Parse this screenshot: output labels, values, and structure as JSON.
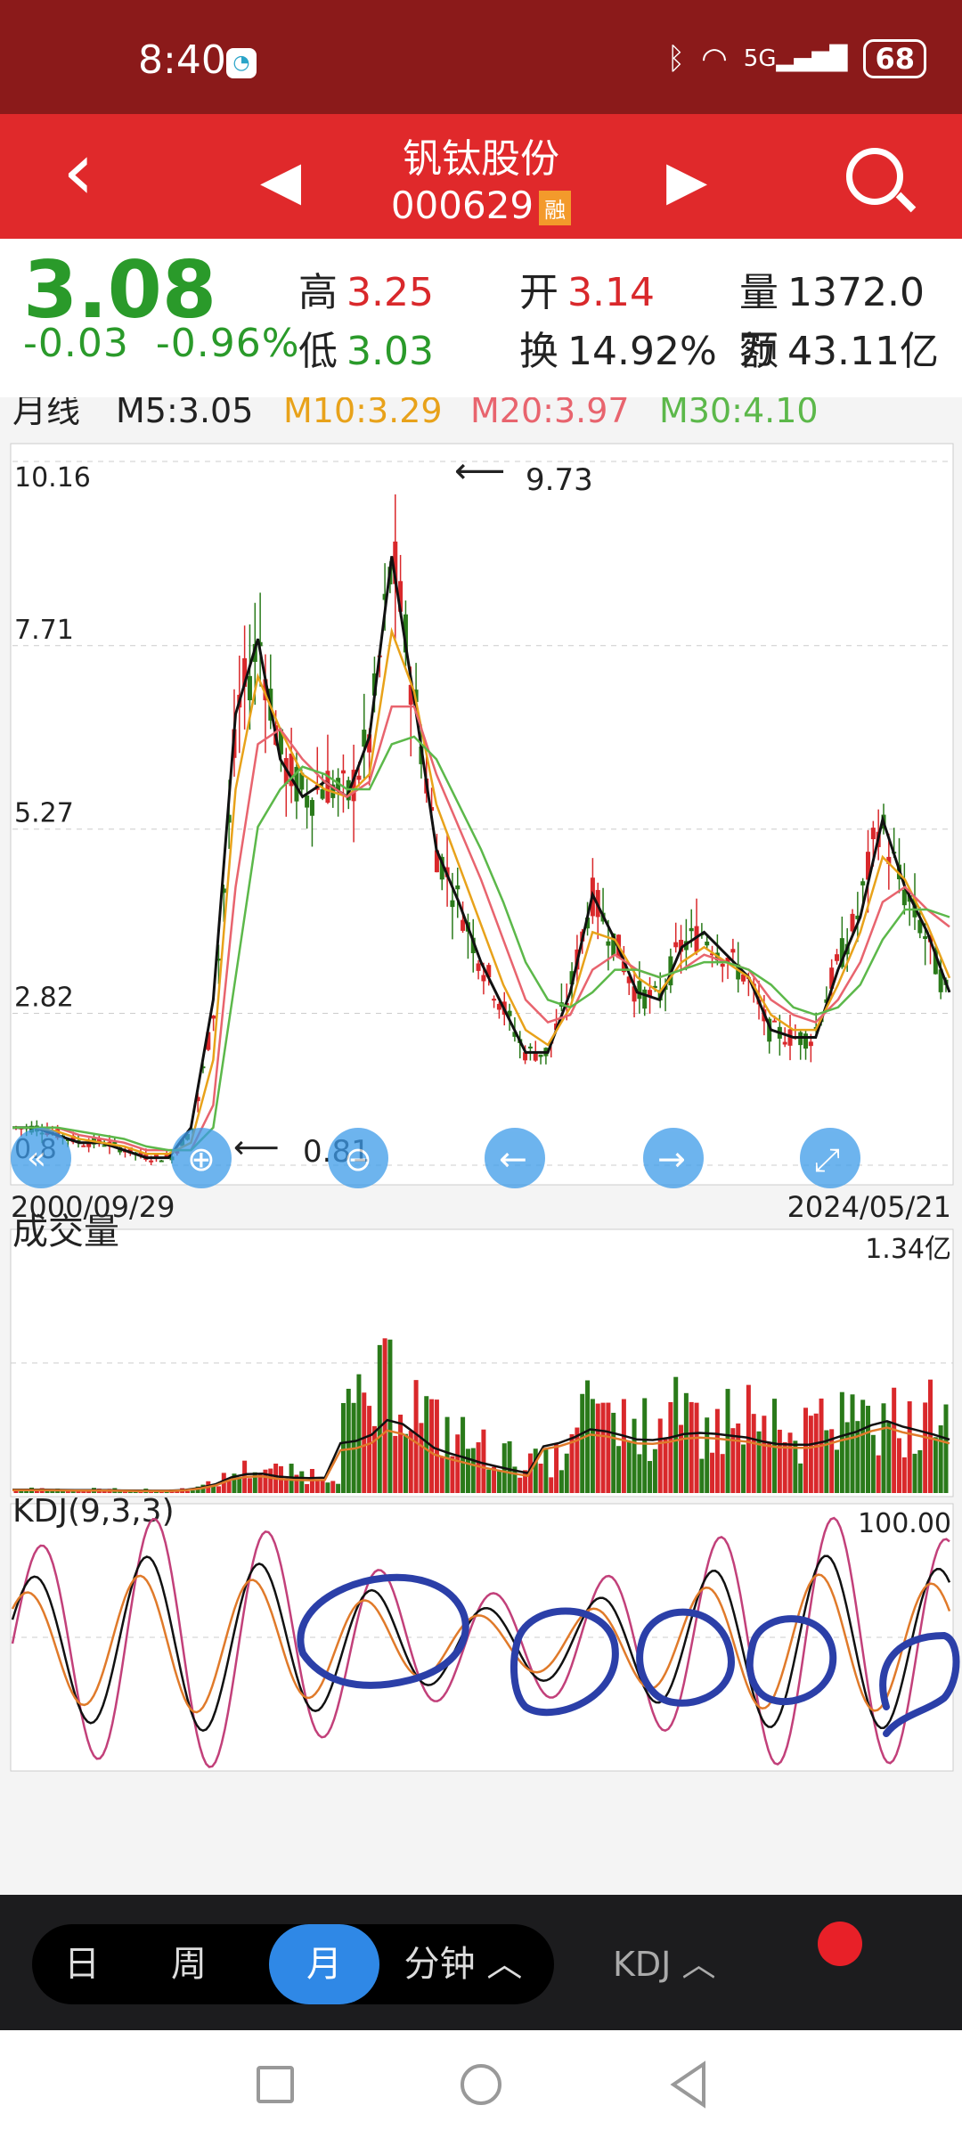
{
  "status": {
    "time": "8:40",
    "battery": "68",
    "signal": "5G"
  },
  "header": {
    "title": "钒钛股份",
    "code": "000629",
    "badge": "融"
  },
  "quote": {
    "price": "3.08",
    "change": "-0.03",
    "change_pct": "-0.96%",
    "high_label": "高",
    "high": "3.25",
    "open_label": "开",
    "open": "3.14",
    "vol_label": "量",
    "vol": "1372.0万",
    "low_label": "低",
    "low": "3.03",
    "turnover_label": "换",
    "turnover": "14.92%",
    "amount_label": "额",
    "amount": "43.11亿"
  },
  "ma_bar": {
    "period": "月线",
    "m5": "M5:3.05",
    "m10": "M10:3.29",
    "m20": "M20:3.97",
    "m30": "M30:4.10"
  },
  "main_chart": {
    "y_ticks": [
      "10.16",
      "7.71",
      "5.27",
      "2.82",
      "0.8"
    ],
    "start_date": "2000/09/29",
    "end_date": "2024/05/21",
    "high_note": "9.73",
    "low_note": "0.81"
  },
  "volume_panel": {
    "title": "成交量",
    "max": "1.34亿"
  },
  "kdj_panel": {
    "title": "KDJ(9,3,3)",
    "max": "100.00"
  },
  "tabs": [
    "日",
    "周",
    "月",
    "分钟 ︿"
  ],
  "active_tab": "月",
  "indicator_button": "KDJ ︿",
  "colors": {
    "header_red": "#e0292b",
    "up": "#d9282b",
    "down": "#2a9a2a",
    "m10": "#e8a21a",
    "m20": "#e8646e",
    "m30": "#5cb84a",
    "active_tab": "#2f88e6"
  },
  "chart_data": {
    "type": "line",
    "title": "",
    "x": [
      "2000/09/29",
      "2024/05/21"
    ],
    "ylim": [
      0.8,
      10.16
    ],
    "y_ticks": [
      10.16,
      7.71,
      5.27,
      2.82,
      0.8
    ],
    "series": [
      {
        "name": "M5",
        "values": [
          1.3,
          1.3,
          1.2,
          1.1,
          1.1,
          1.0,
          0.9,
          0.9,
          1.3,
          3.0,
          6.8,
          7.8,
          6.2,
          5.7,
          5.9,
          5.7,
          6.5,
          8.9,
          7.0,
          5.0,
          4.3,
          3.5,
          2.9,
          2.3,
          2.3,
          3.1,
          4.4,
          3.8,
          3.1,
          3.0,
          3.7,
          3.9,
          3.6,
          3.3,
          2.6,
          2.5,
          2.5,
          3.4,
          4.1,
          5.4,
          4.5,
          3.9,
          3.1
        ]
      },
      {
        "name": "M10",
        "values": [
          1.3,
          1.3,
          1.25,
          1.15,
          1.1,
          1.05,
          0.95,
          0.95,
          1.1,
          2.2,
          5.8,
          7.3,
          6.6,
          6.0,
          5.8,
          5.7,
          6.0,
          7.9,
          7.1,
          5.6,
          4.8,
          4.0,
          3.2,
          2.6,
          2.4,
          2.9,
          3.9,
          3.8,
          3.3,
          3.1,
          3.5,
          3.7,
          3.5,
          3.3,
          2.8,
          2.6,
          2.6,
          3.2,
          3.9,
          4.9,
          4.6,
          4.0,
          3.29
        ]
      },
      {
        "name": "M20",
        "values": [
          1.3,
          1.3,
          1.3,
          1.2,
          1.15,
          1.1,
          1.0,
          1.0,
          1.0,
          1.6,
          4.5,
          6.4,
          6.6,
          6.2,
          5.9,
          5.7,
          5.9,
          6.9,
          6.9,
          6.0,
          5.3,
          4.6,
          3.8,
          3.0,
          2.7,
          2.8,
          3.4,
          3.6,
          3.4,
          3.3,
          3.4,
          3.6,
          3.5,
          3.4,
          3.0,
          2.8,
          2.7,
          3.0,
          3.5,
          4.3,
          4.5,
          4.2,
          3.97
        ]
      },
      {
        "name": "M30",
        "values": [
          1.3,
          1.3,
          1.3,
          1.25,
          1.2,
          1.15,
          1.05,
          1.0,
          1.0,
          1.3,
          3.3,
          5.3,
          5.8,
          6.1,
          6.0,
          5.8,
          5.8,
          6.4,
          6.5,
          6.2,
          5.6,
          5.0,
          4.3,
          3.5,
          3.0,
          2.9,
          3.1,
          3.4,
          3.4,
          3.3,
          3.4,
          3.5,
          3.5,
          3.4,
          3.2,
          2.9,
          2.8,
          2.9,
          3.2,
          3.8,
          4.2,
          4.2,
          4.1
        ]
      }
    ]
  }
}
